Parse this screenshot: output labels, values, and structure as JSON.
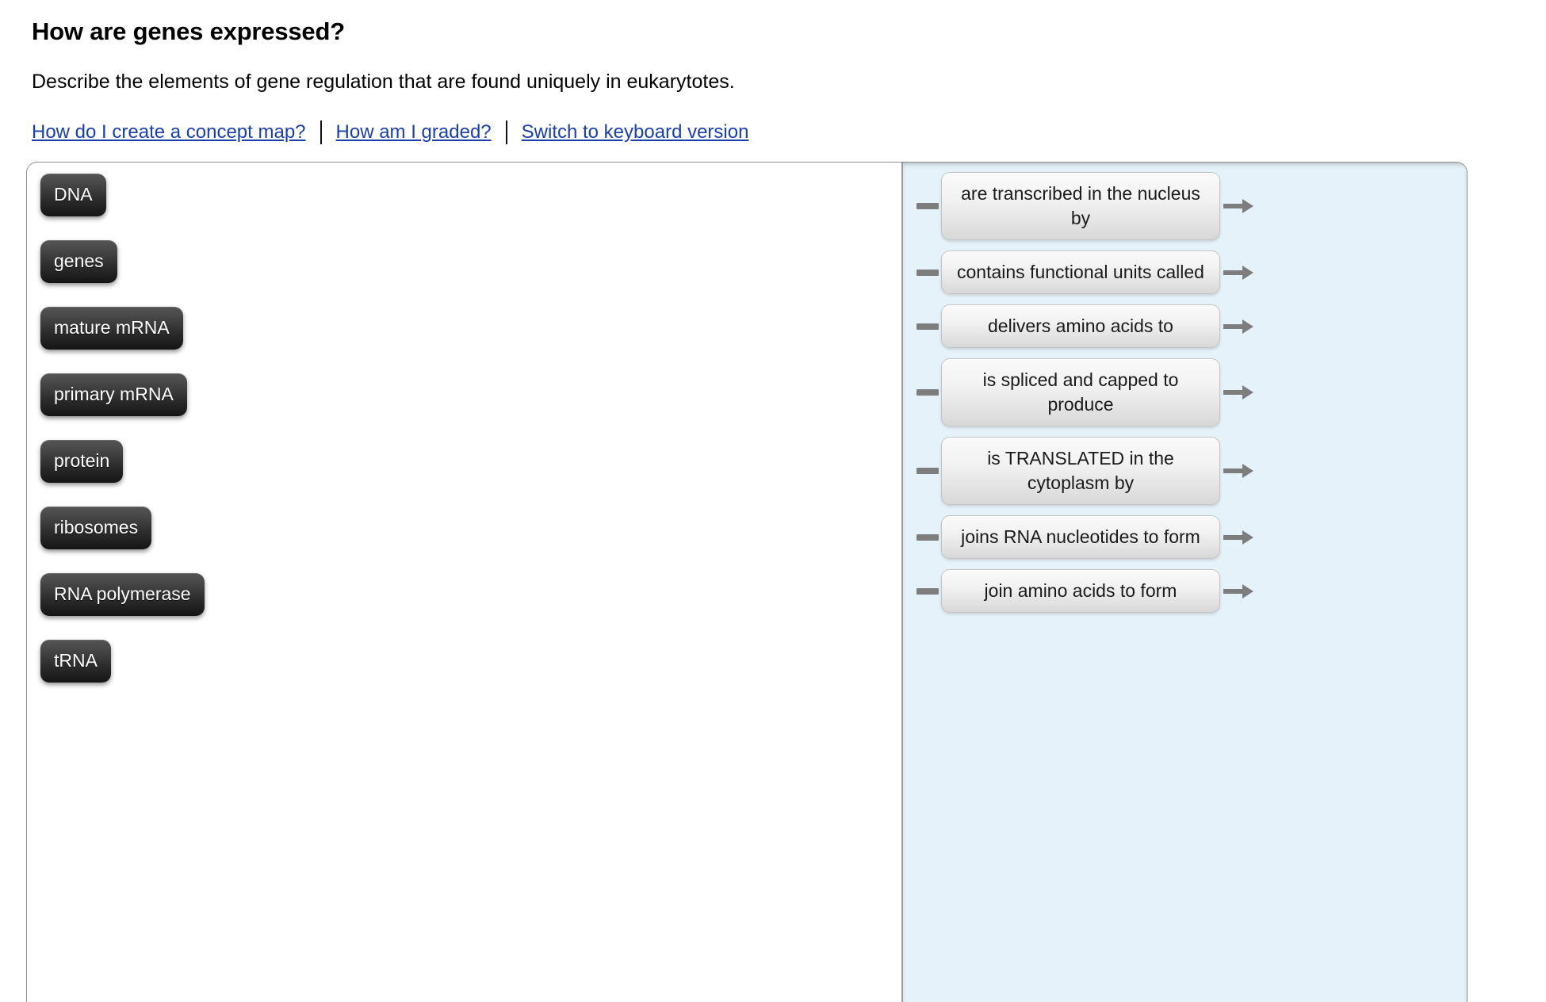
{
  "header": {
    "title": "How are genes expressed?",
    "subtitle": "Describe the elements of gene regulation that are found uniquely in eukarytotes.",
    "links": [
      {
        "label": "How do I create a concept map?"
      },
      {
        "label": "How am I graded?"
      },
      {
        "label": "Switch to keyboard version"
      }
    ]
  },
  "workspace": {
    "canvas": {
      "nodes": [
        {
          "label": "DNA"
        },
        {
          "label": "genes"
        },
        {
          "label": "mature mRNA"
        },
        {
          "label": "primary mRNA"
        },
        {
          "label": "protein"
        },
        {
          "label": "ribosomes"
        },
        {
          "label": "RNA polymerase"
        },
        {
          "label": "tRNA"
        }
      ]
    },
    "phrase_bank": {
      "background_color": "#e6f2f9",
      "phrases": [
        {
          "label": "are transcribed in the nucleus by"
        },
        {
          "label": "contains functional units called"
        },
        {
          "label": "delivers amino acids to"
        },
        {
          "label": "is spliced and capped to produce"
        },
        {
          "label": "is TRANSLATED in the cytoplasm by"
        },
        {
          "label": "joins RNA nucleotides to form"
        },
        {
          "label": "join amino acids to form"
        }
      ]
    }
  },
  "colors": {
    "link": "#1a3faa",
    "node_top": "#545454",
    "node_bottom": "#151515",
    "panel_blue": "#e6f2f9",
    "connector_gray": "#7d7d7d"
  }
}
